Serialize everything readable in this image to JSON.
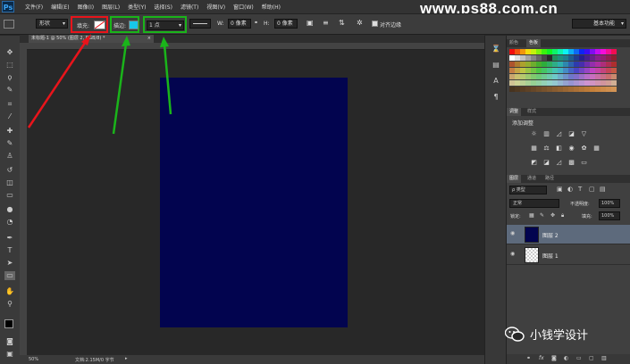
{
  "app_logo": "Ps",
  "menu": [
    "文件(F)",
    "编辑(E)",
    "图像(I)",
    "图层(L)",
    "类型(Y)",
    "选择(S)",
    "滤镜(T)",
    "视图(V)",
    "窗口(W)",
    "帮助(H)"
  ],
  "watermark": "www.ps88.com.cn",
  "options": {
    "mode": "形状",
    "fill_label": "填充:",
    "stroke_label": "描边:",
    "stroke_size": "1 点",
    "w_label": "W:",
    "w_value": "0 像素",
    "h_label": "H:",
    "h_value": "0 像素",
    "align_edges": "对齐边缘",
    "workspace": "基本功能"
  },
  "document_tab": "未标题-1 @ 50% (图层 2, RGB/8) *",
  "status": {
    "zoom": "50%",
    "doc_info": "文档:2.15M/0 字节"
  },
  "panels": {
    "color_tabs": [
      "颜色",
      "色板"
    ],
    "adjust_tabs": [
      "调整",
      "样式"
    ],
    "adjust_title": "添加调整",
    "layers_tabs": [
      "图层",
      "通道",
      "路径"
    ],
    "kind": "ρ 类型",
    "blend_mode": "正常",
    "opacity_label": "不透明度:",
    "opacity_value": "100%",
    "lock_label": "锁定:",
    "fill_label": "填充:",
    "fill_value": "100%",
    "layers": [
      {
        "name": "图层 2"
      },
      {
        "name": "图层 1"
      }
    ]
  },
  "wechat": "小钱学设计",
  "colors": {
    "document": "#02044f",
    "highlight_red": "#e8141b",
    "highlight_green": "#1ab41a",
    "stroke_swatch": "#18c8e8"
  }
}
